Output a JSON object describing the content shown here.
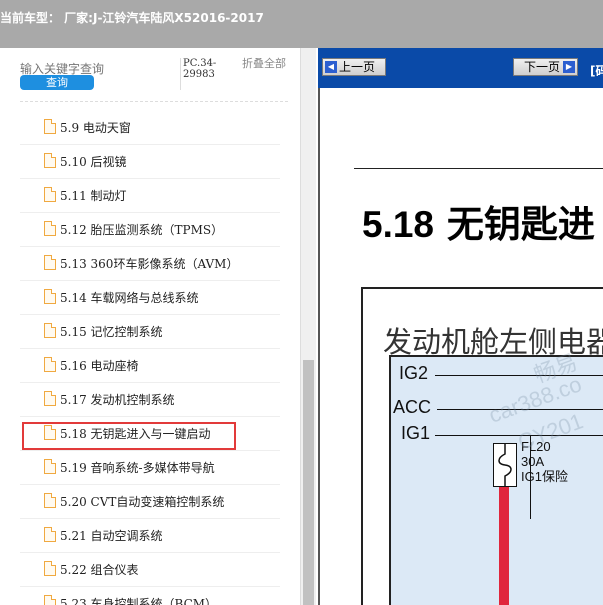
{
  "app": {
    "title": "当前车型： 厂家:J-江铃汽车陆风X52016-2017"
  },
  "sidebar": {
    "search_placeholder": "输入关键字查询",
    "search_button": "查询",
    "code": "PC.34-29983",
    "fold_all": "折叠全部",
    "items": [
      {
        "label": "5.9 电动天窗"
      },
      {
        "label": "5.10 后视镜"
      },
      {
        "label": "5.11 制动灯"
      },
      {
        "label": "5.12 胎压监测系统（TPMS）"
      },
      {
        "label": "5.13 360环车影像系统（AVM）"
      },
      {
        "label": "5.14 车载网络与总线系统"
      },
      {
        "label": "5.15 记忆控制系统"
      },
      {
        "label": "5.16 电动座椅"
      },
      {
        "label": "5.17 发动机控制系统"
      },
      {
        "label": "5.18 无钥匙进入与一键启动"
      },
      {
        "label": "5.19 音响系统-多媒体带导航"
      },
      {
        "label": "5.20 CVT自动变速箱控制系统"
      },
      {
        "label": "5.21 自动空调系统"
      },
      {
        "label": "5.22 组合仪表"
      },
      {
        "label": "5.23 车身控制系统（BCM）"
      }
    ],
    "selected_index": 9
  },
  "viewer": {
    "prev_label": "上一页",
    "next_label": "下一页",
    "extra_label": "[码",
    "heading_num": "5.18",
    "heading_text": "无钥匙进",
    "diagram": {
      "title": "发动机舱左侧电器",
      "signals": [
        "IG2",
        "ACC",
        "IG1"
      ],
      "fuse_id": "FL20",
      "fuse_rating": "30A",
      "fuse_name": "IG1保险",
      "watermarks": [
        "畅易",
        "car388.co",
        "CY201"
      ]
    }
  },
  "colors": {
    "topbar": "#a9a9a9",
    "toolbar": "#0a4aa8",
    "search_button": "#1e8fe0",
    "highlight": "#e23a3a",
    "wire": "#e0263c",
    "diagram_fill": "#dce9f6"
  }
}
